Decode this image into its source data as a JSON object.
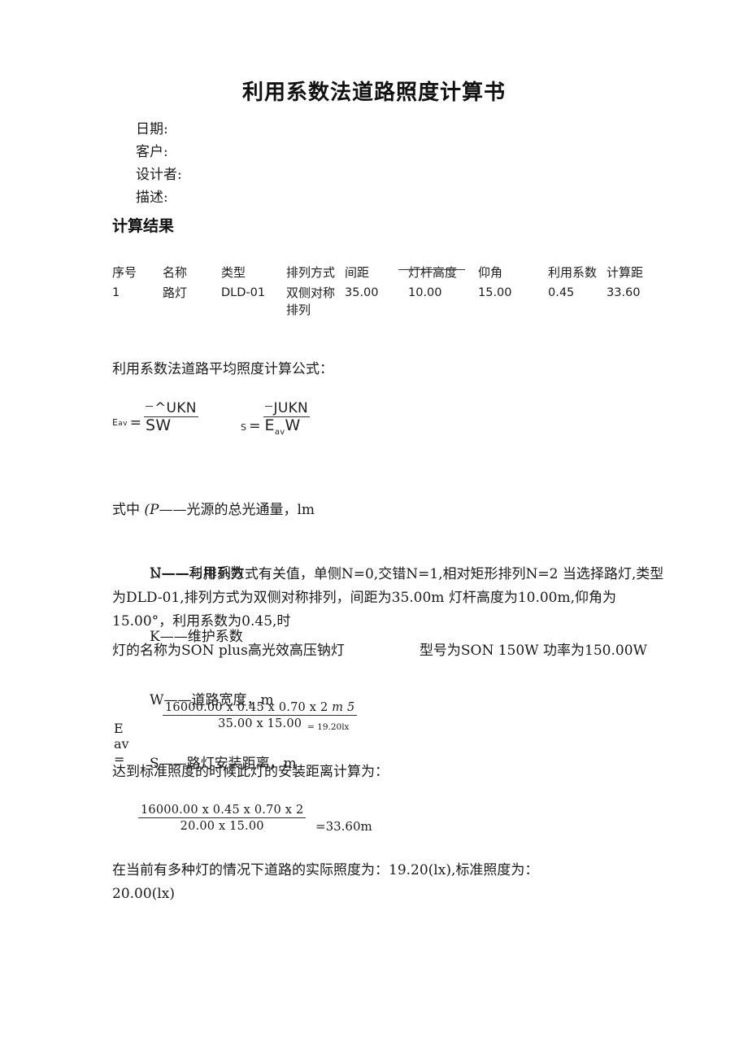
{
  "document": {
    "title": "利用系数法道路照度计算书",
    "meta_fields": [
      {
        "label": "日期:"
      },
      {
        "label": "客户:"
      },
      {
        "label": "设计者:"
      },
      {
        "label": "描述:"
      }
    ],
    "section_heading": "计算结果"
  },
  "results_table": {
    "headers": {
      "no": "序号",
      "name": "名称",
      "type": "类型",
      "arrangement": "排列方式",
      "spacing": "间距",
      "pole_height": "灯杆高度",
      "tilt_angle": "仰角",
      "utilization": "利用系数",
      "calc_distance": "计算距"
    },
    "rows": [
      {
        "no": "1",
        "name": "路灯",
        "type": "DLD-01",
        "arrangement": "双侧对称排列",
        "spacing": "35.00",
        "pole_height": "10.00",
        "tilt_angle": "15.00",
        "utilization": "0.45",
        "calc_distance": "33.60"
      }
    ]
  },
  "formula_section": {
    "intro": "利用系数法道路平均照度计算公式：",
    "formula_eav": {
      "lhs": "E",
      "lhs_sub": "av",
      "equals": "=",
      "numerator": "^UKN",
      "denominator": "SW"
    },
    "formula_s": {
      "lhs": "S",
      "equals": "=",
      "numerator": "JUKN",
      "denominator_base": "E",
      "denominator_sub": "av",
      "denominator_tail": "W"
    }
  },
  "variables": {
    "intro": "式中 ",
    "phi_symbol": "(P",
    "phi_desc": "——光源的总光通量，lm",
    "items": [
      "U——利用系数",
      "K——维护系数",
      "W——道路宽度，m",
      "S——路灯安装距离，m",
      "N——与排列方式有关值，单侧N=0,交错N=1,相对矩形排列N=2"
    ]
  },
  "description": {
    "paragraph_1": "当选择路灯,类型为DLD-01,排列方式为双侧对称排列，间距为35.00m 灯杆高度为10.00m,仰角为15.00°，利用系数为0.45,时",
    "lamp_name_label": "灯的名称为SON plus高光效高压钠灯",
    "lamp_model_label": "型号为SON 150W 功率为150.00W"
  },
  "calc_eav": {
    "label": "E av =",
    "numerator": "16000.00 x 0.45 x 0.70 x 2",
    "numerator_suffix": "m 5",
    "denominator": "35.00 x 15.00",
    "result": "= 19.20lx"
  },
  "calc_distance": {
    "intro": "达到标准照度的时候此灯的安装距离计算为：",
    "numerator": "16000.00 x 0.45 x 0.70 x 2",
    "denominator": "20.00 x 15.00",
    "result": "=33.60m"
  },
  "conclusion": {
    "line_1": "在当前有多种灯的情况下道路的实际照度为：19.20(lx),标准照度为：",
    "line_2": "20.00(lx)"
  },
  "colors": {
    "page_background": "#ffffff",
    "text": "#1a1a1a",
    "rule": "#333333"
  }
}
